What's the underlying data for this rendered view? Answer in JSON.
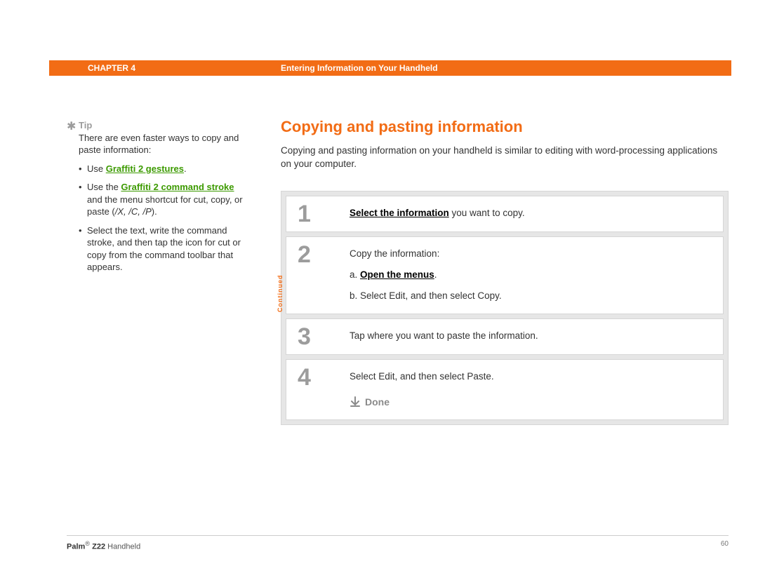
{
  "header": {
    "chapter": "CHAPTER 4",
    "title": "Entering Information on Your Handheld"
  },
  "sidebar": {
    "tip_label": "Tip",
    "intro": "There are even faster ways to copy and paste information:",
    "bullet1_prefix": "Use ",
    "bullet1_link": "Graffiti 2 gestures",
    "bullet1_suffix": ".",
    "bullet2_prefix": "Use the ",
    "bullet2_link": "Graffiti 2 command stroke",
    "bullet2_mid": " and the menu shortcut for cut, copy, or paste (",
    "bullet2_ital": "/X, /C, /P",
    "bullet2_suffix": ").",
    "bullet3": "Select the text, write the command stroke, and then tap the icon for cut or copy from the command toolbar that appears."
  },
  "main": {
    "title": "Copying and pasting information",
    "intro": "Copying and pasting information on your handheld is similar to editing with word-processing applications on your computer."
  },
  "steps": {
    "s1": {
      "num": "1",
      "link": "Select the information",
      "rest": " you want to copy."
    },
    "s2": {
      "num": "2",
      "lead": "Copy the information:",
      "a_prefix": "a.  ",
      "a_link": "Open the menus",
      "a_suffix": ".",
      "b": "b.  Select Edit, and then select Copy."
    },
    "s3": {
      "num": "3",
      "text": "Tap where you want to paste the information."
    },
    "s4": {
      "num": "4",
      "text": "Select Edit, and then select Paste.",
      "done": "Done"
    },
    "cont": "Continued"
  },
  "footer": {
    "brand": "Palm",
    "reg": "®",
    "model": " Z22",
    "tail": " Handheld",
    "page": "60"
  }
}
